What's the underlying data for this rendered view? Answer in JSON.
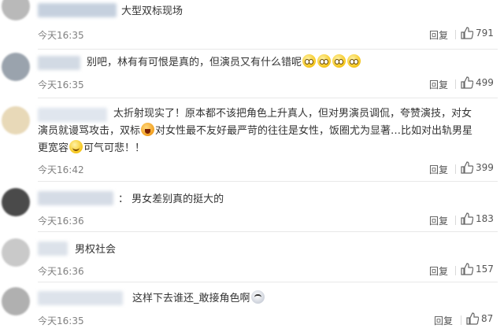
{
  "comments": [
    {
      "text": "大型双标现场",
      "time": "今天16:35",
      "reply": "回复",
      "likes": "791"
    },
    {
      "text": "别吧，林有有可恨是真的，但演员又有什么错呢",
      "time": "今天16:35",
      "reply": "回复",
      "likes": "499"
    },
    {
      "text_a": "太折射现实了！原本都不该把角色上升真人，但对男演员调侃，夸赞演技，对女演员就谩骂攻击，双标",
      "text_b": "对女性最不友好最严苛的往往是女性，饭圈尤为显著…比如对出轨男星更宽容",
      "text_c": "可气可悲！！",
      "time": "今天16:42",
      "reply": "回复",
      "likes": "399"
    },
    {
      "text": "：  男女差别真的挺大的",
      "time": "今天16:36",
      "reply": "回复",
      "likes": "183"
    },
    {
      "text": "男权社会",
      "time": "今天16:36",
      "reply": "回复",
      "likes": "157"
    },
    {
      "text": "这样下去谁还_敢接角色啊",
      "time": "今天16:35",
      "reply": "回复",
      "likes": "87"
    }
  ],
  "icons": {
    "like": "thumbs-up-icon",
    "emoji_smile": "emoji-smile-icon",
    "emoji_cry": "emoji-cry-icon",
    "emoji_face": "emoji-face-icon"
  },
  "colors": {
    "meta": "#808080",
    "separator": "#e8e8e8"
  }
}
